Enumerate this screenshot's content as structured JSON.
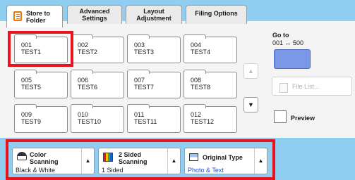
{
  "tabs": [
    {
      "label_line1": "Store to",
      "label_line2": "Folder"
    },
    {
      "label_line1": "Advanced",
      "label_line2": "Settings"
    },
    {
      "label_line1": "Layout",
      "label_line2": "Adjustment"
    },
    {
      "label_line1": "Filing Options",
      "label_line2": ""
    }
  ],
  "folders": [
    {
      "number": "001",
      "name": "TEST1"
    },
    {
      "number": "002",
      "name": "TEST2"
    },
    {
      "number": "003",
      "name": "TEST3"
    },
    {
      "number": "004",
      "name": "TEST4"
    },
    {
      "number": "005",
      "name": "TEST5"
    },
    {
      "number": "006",
      "name": "TEST6"
    },
    {
      "number": "007",
      "name": "TEST7"
    },
    {
      "number": "008",
      "name": "TEST8"
    },
    {
      "number": "009",
      "name": "TEST9"
    },
    {
      "number": "010",
      "name": "TEST10"
    },
    {
      "number": "011",
      "name": "TEST11"
    },
    {
      "number": "012",
      "name": "TEST12"
    }
  ],
  "goto": {
    "label": "Go to",
    "range": "001 ↔ 500"
  },
  "file_list": "File List...",
  "preview": "Preview",
  "nav": {
    "up_icon": "▲",
    "down_icon": "▼"
  },
  "features": [
    {
      "title_line1": "Color",
      "title_line2": "Scanning",
      "value": "Black & White",
      "icon": "color-scanning-icon"
    },
    {
      "title_line1": "2 Sided",
      "title_line2": "Scanning",
      "value": "1 Sided",
      "icon": "two-sided-icon"
    },
    {
      "title_line1": "Original Type",
      "title_line2": "",
      "value": "Photo & Text",
      "icon": "original-type-icon"
    }
  ],
  "colors": {
    "accent_blue": "#7a97e8",
    "band": "#8fcef0",
    "highlight_red": "#e8131e",
    "link_blue": "#1f4fd1"
  }
}
